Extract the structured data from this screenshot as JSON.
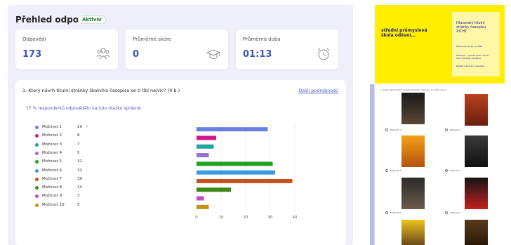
{
  "header": {
    "title": "Přehled odpovědí",
    "badge": "Aktivní"
  },
  "stats": [
    {
      "label": "Odpovědi",
      "value": "173",
      "icon": "people-icon"
    },
    {
      "label": "Průměrné skóre",
      "value": "0",
      "icon": "graduation-cap-icon"
    },
    {
      "label": "Průměrná doba",
      "value": "01:13",
      "icon": "alarm-clock-icon"
    }
  ],
  "question": {
    "title": "1. Který návrh titulní stránky školního časopisu se ti líbí nejvíc? (0 b.)",
    "more_link": "Další podrobnosti",
    "info": "17 % respondentů odpovědělo na tuto otázku správně."
  },
  "chart_data": {
    "type": "bar",
    "orientation": "horizontal",
    "categories": [
      "Možnost 1",
      "Možnost 2",
      "Možnost 3",
      "Možnost 4",
      "Možnost 5",
      "Možnost 6",
      "Možnost 7",
      "Možnost 8",
      "Možnost 9",
      "Možnost 10"
    ],
    "values": [
      29,
      8,
      7,
      5,
      31,
      32,
      39,
      14,
      3,
      5
    ],
    "colors": [
      "#6b7fe0",
      "#d0188a",
      "#22a3a3",
      "#9b6fd6",
      "#23a021",
      "#3d9be0",
      "#c8521b",
      "#3e8a17",
      "#c34fc4",
      "#c29212"
    ],
    "correct_index": 0,
    "xlim": [
      0,
      40
    ],
    "xticks": [
      "0",
      "10",
      "20",
      "30",
      "40"
    ],
    "legend_placement": "left"
  },
  "slide": {
    "heading": "střední průmyslová škola oděvní...",
    "box_title": "Hlasování titulní stránky časopisu XICHT",
    "box_sub": "Hlasování do 30. 4. 2023",
    "box_text": "Hlasujte – vyberte jeden návrh titulní stránky časopisu.",
    "box_footer": "Redakce školního časopisu"
  },
  "form_preview": {
    "question": "1. Který návrh titulní stránky školního časopisu se ti líbí nejvíc?",
    "options": [
      "Možnost 1",
      "Možnost 2",
      "Možnost 3",
      "Možnost 4",
      "Možnost 5",
      "Možnost 6"
    ]
  }
}
